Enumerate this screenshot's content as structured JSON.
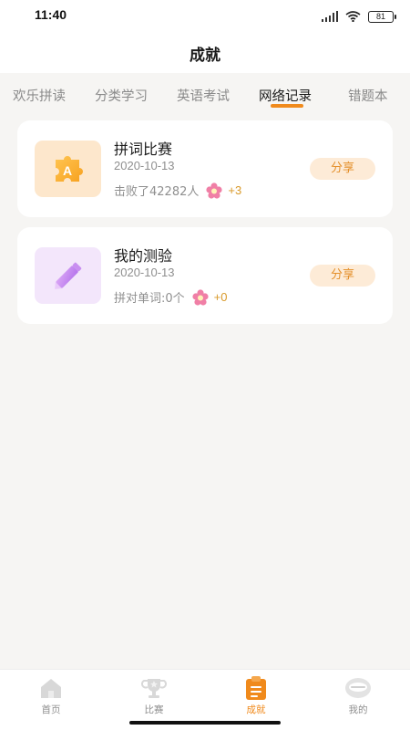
{
  "status_bar": {
    "time": "11:40",
    "battery": "81"
  },
  "header": {
    "title": "成就"
  },
  "tabs": [
    {
      "label": "欢乐拼读",
      "active": false
    },
    {
      "label": "分类学习",
      "active": false
    },
    {
      "label": "英语考试",
      "active": false
    },
    {
      "label": "网络记录",
      "active": true
    },
    {
      "label": "错题本",
      "active": false
    }
  ],
  "records": [
    {
      "icon": "puzzle-icon",
      "icon_letter": "A",
      "title": "拼词比赛",
      "date": "2020-10-13",
      "stat": "击败了42282人",
      "reward": "+3",
      "share_label": "分享"
    },
    {
      "icon": "pencil-icon",
      "title": "我的测验",
      "date": "2020-10-13",
      "stat": "拼对单词:0个",
      "reward": "+0",
      "share_label": "分享"
    }
  ],
  "bottom_nav": [
    {
      "label": "首页",
      "icon": "home-icon",
      "active": false
    },
    {
      "label": "比赛",
      "icon": "trophy-icon",
      "active": false
    },
    {
      "label": "成就",
      "icon": "clipboard-icon",
      "active": true
    },
    {
      "label": "我的",
      "icon": "profile-icon",
      "active": false
    }
  ],
  "colors": {
    "accent": "#f08a1c",
    "share_bg": "#fdebd7",
    "background": "#f6f5f3"
  }
}
